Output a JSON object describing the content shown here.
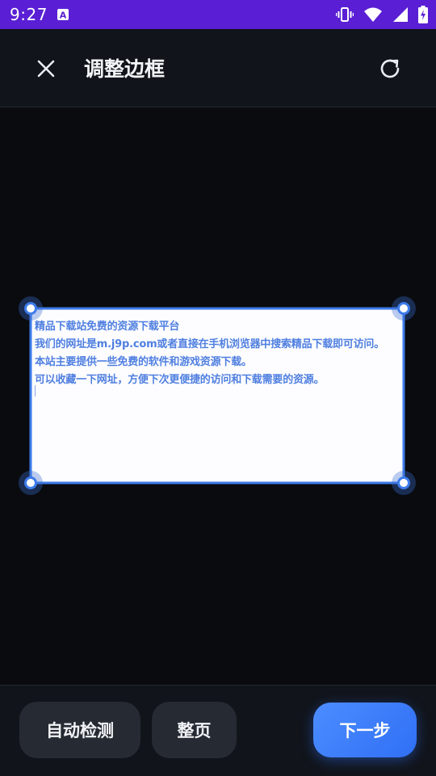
{
  "status_bar": {
    "time": "9:27",
    "icons": [
      "accessibility-a-icon",
      "vibrate-icon",
      "wifi-icon",
      "signal-icon",
      "battery-icon"
    ]
  },
  "header": {
    "title": "调整边框",
    "close_icon": "close-icon",
    "refresh_icon": "refresh-icon"
  },
  "document": {
    "lines": [
      "精品下载站免费的资源下载平台",
      "我们的网址是m.j9p.com或者直接在手机浏览器中搜索精品下载即可访问。",
      "本站主要提供一些免费的软件和游戏资源下载。",
      "可以收藏一下网址，方便下次更便捷的访问和下载需要的资源。"
    ]
  },
  "footer": {
    "auto_detect_label": "自动检测",
    "full_page_label": "整页",
    "next_label": "下一步"
  },
  "colors": {
    "accent": "#3d7bea",
    "status_bar": "#5a1fd4",
    "background": "#090b0f"
  }
}
